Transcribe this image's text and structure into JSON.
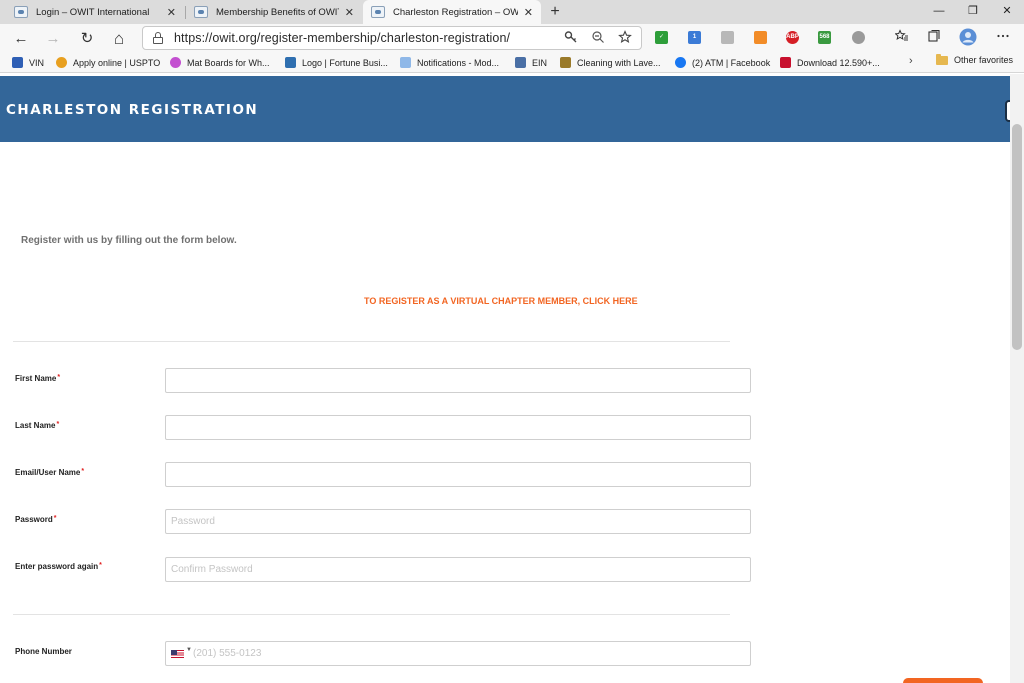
{
  "browser": {
    "tabs": [
      {
        "title": "Login – OWIT International",
        "close": "✕"
      },
      {
        "title": "Membership Benefits of OWIT –",
        "close": "✕"
      },
      {
        "title": "Charleston Registration – OWIT I",
        "close": "✕"
      }
    ],
    "new_tab": "+",
    "window_controls": {
      "minimize": "—",
      "restore": "❐",
      "close": "✕"
    },
    "nav": {
      "back": "←",
      "forward": "→",
      "refresh": "↻",
      "home": "⌂"
    },
    "url": "https://owit.org/register-membership/charleston-registration/",
    "extensions": [
      {
        "name": "check-extension",
        "color": "#2e9e3a",
        "label": "✓"
      },
      {
        "name": "notification-extension",
        "color": "#3b7bd6",
        "label": "1"
      },
      {
        "name": "gray-extension",
        "color": "#b8b8b8",
        "label": ""
      },
      {
        "name": "orange-extension",
        "color": "#f28c28",
        "label": ""
      },
      {
        "name": "abp-extension",
        "color": "#d51f26",
        "label": "ABP"
      },
      {
        "name": "counter-extension",
        "color": "#3a9a40",
        "label": "568"
      },
      {
        "name": "shield-extension",
        "color": "#9a9a9a",
        "label": ""
      }
    ]
  },
  "favorites": {
    "items": [
      {
        "label": "VIN",
        "color": "#2f5fb5"
      },
      {
        "label": "Apply online | USPTO",
        "color": "#e8a020"
      },
      {
        "label": "Mat Boards for Wh...",
        "color": "#c34fd0"
      },
      {
        "label": "Logo | Fortune Busi...",
        "color": "#2f6fb0"
      },
      {
        "label": "Notifications - Mod...",
        "color": "#8fb8e8"
      },
      {
        "label": "EIN",
        "color": "#4a6fa5"
      },
      {
        "label": "Cleaning with Lave...",
        "color": "#9a7a2a"
      },
      {
        "label": "(2) ATM | Facebook",
        "color": "#1877f2"
      },
      {
        "label": "Download 12.590+...",
        "color": "#c8102e"
      }
    ],
    "more": "›",
    "other": "Other favorites"
  },
  "page": {
    "banner_title": "CHARLESTON REGISTRATION",
    "intro": "Register with us by filling out the form below.",
    "virtual_link": "TO REGISTER AS A VIRTUAL CHAPTER MEMBER, CLICK HERE",
    "required_mark": "*",
    "fields": {
      "first_name": {
        "label": "First Name",
        "placeholder": ""
      },
      "last_name": {
        "label": "Last Name",
        "placeholder": ""
      },
      "email": {
        "label": "Email/User Name",
        "placeholder": ""
      },
      "password": {
        "label": "Password",
        "placeholder": "Password"
      },
      "confirm": {
        "label": "Enter password again",
        "placeholder": "Confirm Password"
      },
      "phone": {
        "label": "Phone Number",
        "placeholder": "(201) 555-0123",
        "country_caret": "▼"
      }
    }
  }
}
